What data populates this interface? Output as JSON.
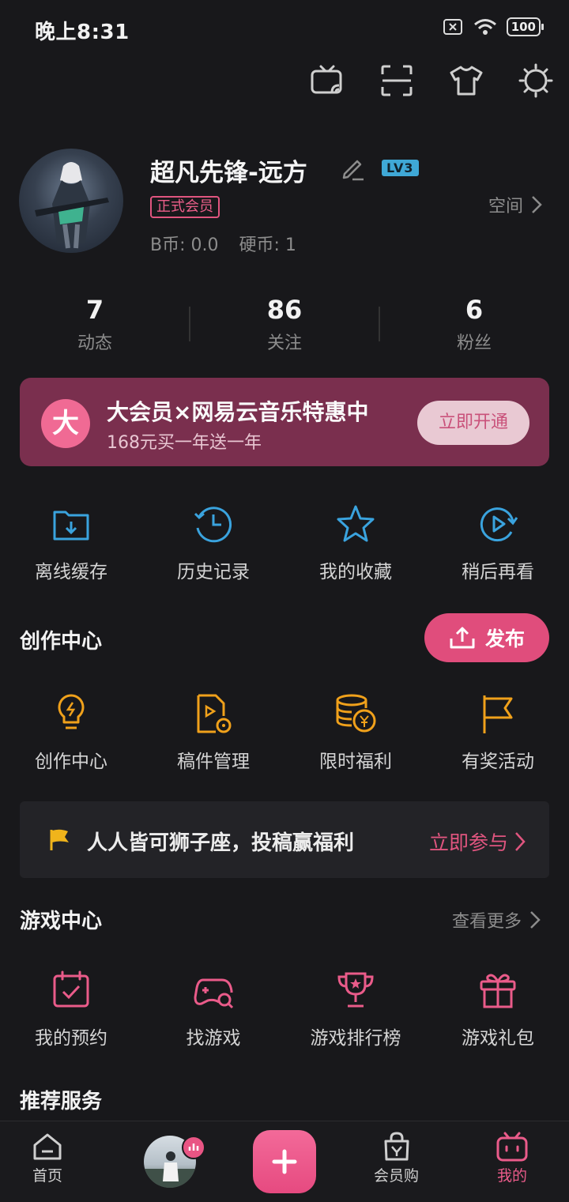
{
  "status_bar": {
    "time": "晚上8:31",
    "battery": "100"
  },
  "top_icons": [
    "tv-cast-icon",
    "scan-icon",
    "tshirt-icon",
    "brightness-icon"
  ],
  "profile": {
    "username": "超凡先锋-远方",
    "level": "LV3",
    "vip_tag": "正式会员",
    "b_coin": "B币: 0.0",
    "hard_coin": "硬币: 1",
    "space_label": "空间"
  },
  "stats": [
    {
      "value": "7",
      "label": "动态"
    },
    {
      "value": "86",
      "label": "关注"
    },
    {
      "value": "6",
      "label": "粉丝"
    }
  ],
  "vip_banner": {
    "logo": "大",
    "title": "大会员×网易云音乐特惠中",
    "subtitle": "168元买一年送一年",
    "button": "立即开通"
  },
  "quick_actions": [
    {
      "label": "离线缓存",
      "icon": "download-folder-icon"
    },
    {
      "label": "历史记录",
      "icon": "history-clock-icon"
    },
    {
      "label": "我的收藏",
      "icon": "star-icon"
    },
    {
      "label": "稍后再看",
      "icon": "watch-later-icon"
    }
  ],
  "creator_center": {
    "title": "创作中心",
    "publish_button": "发布",
    "items": [
      {
        "label": "创作中心",
        "icon": "lightbulb-icon"
      },
      {
        "label": "稿件管理",
        "icon": "manuscript-icon"
      },
      {
        "label": "限时福利",
        "icon": "coins-icon"
      },
      {
        "label": "有奖活动",
        "icon": "flag-icon"
      }
    ],
    "promo_text": "人人皆可狮子座，投稿赢福利",
    "promo_link": "立即参与"
  },
  "game_center": {
    "title": "游戏中心",
    "more_label": "查看更多",
    "items": [
      {
        "label": "我的预约",
        "icon": "calendar-check-icon"
      },
      {
        "label": "找游戏",
        "icon": "gamepad-search-icon"
      },
      {
        "label": "游戏排行榜",
        "icon": "trophy-icon"
      },
      {
        "label": "游戏礼包",
        "icon": "gift-icon"
      }
    ]
  },
  "recommended_title": "推荐服务",
  "bottom_nav": [
    {
      "label": "首页",
      "icon": "home-icon"
    },
    {
      "label": "",
      "icon": "avatar-story"
    },
    {
      "label": "",
      "icon": "plus-icon"
    },
    {
      "label": "会员购",
      "icon": "shopping-bag-icon"
    },
    {
      "label": "我的",
      "icon": "bilibili-tv-icon"
    }
  ],
  "colors": {
    "accent_pink": "#e04d7c",
    "blue_icons": "#3aa3de",
    "orange_icons": "#f0a11b",
    "game_pink": "#ea5b8a"
  }
}
